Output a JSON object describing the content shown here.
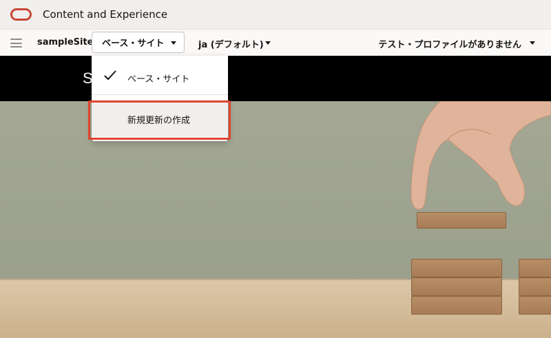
{
  "app": {
    "title": "Content and Experience"
  },
  "toolbar": {
    "site_name": "sampleSite",
    "site_dropdown_label": "ベース・サイト",
    "language_label": "ja (デフォルト)",
    "profile_label": "テスト・プロファイルがありません"
  },
  "banner": {
    "initial": "S"
  },
  "dropdown": {
    "items": [
      {
        "label": "ベース・サイト",
        "checked": true
      },
      {
        "label": "新規更新の作成",
        "checked": false
      }
    ]
  },
  "colors": {
    "brand": "#c74634",
    "highlight": "#e0442f",
    "banner_bg": "#000000",
    "toolbar_bg": "#fbf9f8"
  },
  "icons": {
    "logo": "oracle-logo-icon",
    "menu": "hamburger-menu-icon",
    "caret": "caret-down-icon",
    "check": "checkmark-icon"
  }
}
